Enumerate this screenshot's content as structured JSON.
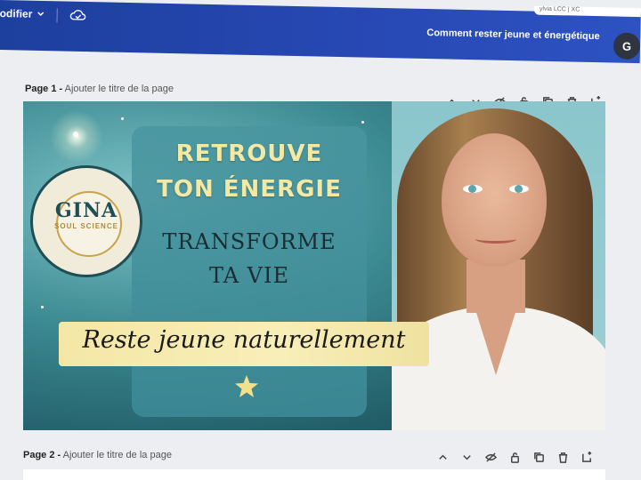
{
  "topbar": {
    "edit_label": "odifier",
    "document_title": "Comment rester jeune et énergétique",
    "avatar_initial": "G",
    "corner_text": "ylvia LCC | XC"
  },
  "pages": [
    {
      "number_label": "Page 1 -",
      "title_placeholder": "Ajouter le titre de la page"
    },
    {
      "number_label": "Page 2 -",
      "title_placeholder": "Ajouter le titre de la page"
    }
  ],
  "page_tools": [
    "chevron-up-icon",
    "chevron-down-icon",
    "hide-icon",
    "lock-icon",
    "duplicate-icon",
    "trash-icon",
    "add-page-icon"
  ],
  "design": {
    "headline_line1": "RETROUVE",
    "headline_line2": "TON ÉNERGIE",
    "subhead_line1": "TRANSFORME",
    "subhead_line2": "TA VIE",
    "banner_text": "Reste jeune naturellement",
    "logo_name": "GINA",
    "logo_subtitle": "SOUL SCIENCE"
  },
  "colors": {
    "topbar": "#2748b3",
    "headline": "#f3e9a3",
    "banner": "#f4e7a6",
    "panel": "#4a96a0"
  }
}
